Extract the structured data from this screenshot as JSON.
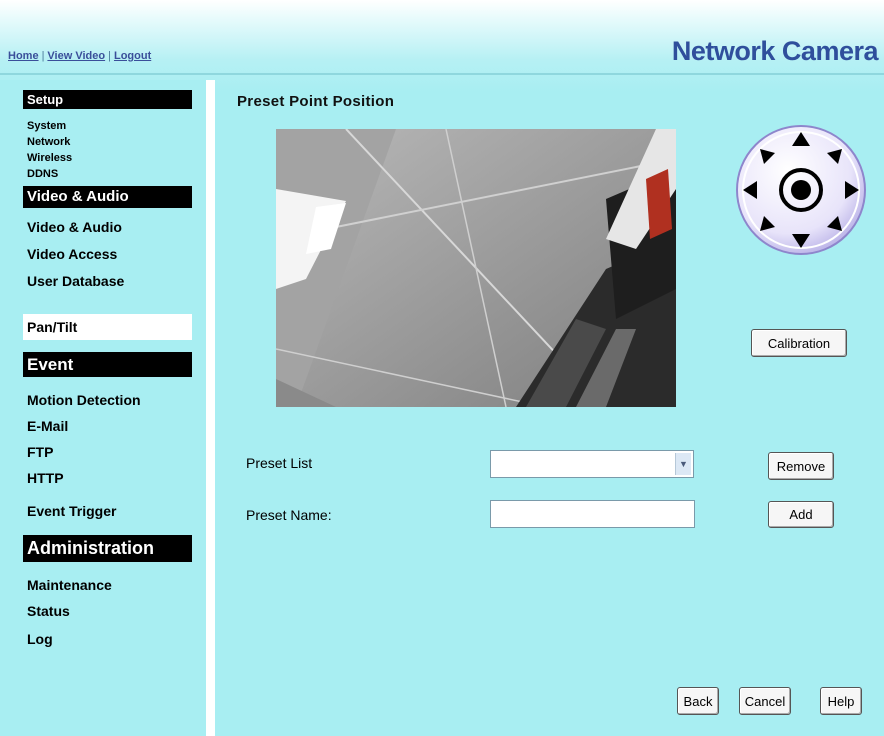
{
  "header": {
    "links": [
      "Home",
      "View Video",
      "Logout"
    ],
    "brand": "Network Camera"
  },
  "sidebar": {
    "sections": [
      {
        "title": "Setup",
        "items": [
          "System",
          "Network",
          "Wireless",
          "DDNS"
        ]
      },
      {
        "title": "Video & Audio",
        "items": [
          "Video & Audio",
          "Video Access",
          "User Database",
          "Pan/Tilt"
        ]
      },
      {
        "title": "Event",
        "items": [
          "Motion Detection",
          "E-Mail",
          "FTP",
          "HTTP",
          "Event Trigger"
        ]
      },
      {
        "title": "Administration",
        "items": [
          "Maintenance",
          "Status",
          "Log"
        ]
      }
    ],
    "active_item": "Pan/Tilt"
  },
  "main": {
    "title": "Preset Point Position",
    "calibration_label": "Calibration",
    "preset_list_label": "Preset List",
    "preset_list_value": "",
    "remove_label": "Remove",
    "preset_name_label": "Preset Name:",
    "preset_name_value": "",
    "add_label": "Add",
    "back_label": "Back",
    "cancel_label": "Cancel",
    "help_label": "Help"
  },
  "icons": {
    "ptz_control": "pan-tilt-direction-pad-icon",
    "select_arrow": "chevron-down-icon"
  },
  "colors": {
    "background": "#a8eef2",
    "brand": "#2f4f9c",
    "section_header": "#000000",
    "ptz_ring": "#c8c0f0"
  }
}
